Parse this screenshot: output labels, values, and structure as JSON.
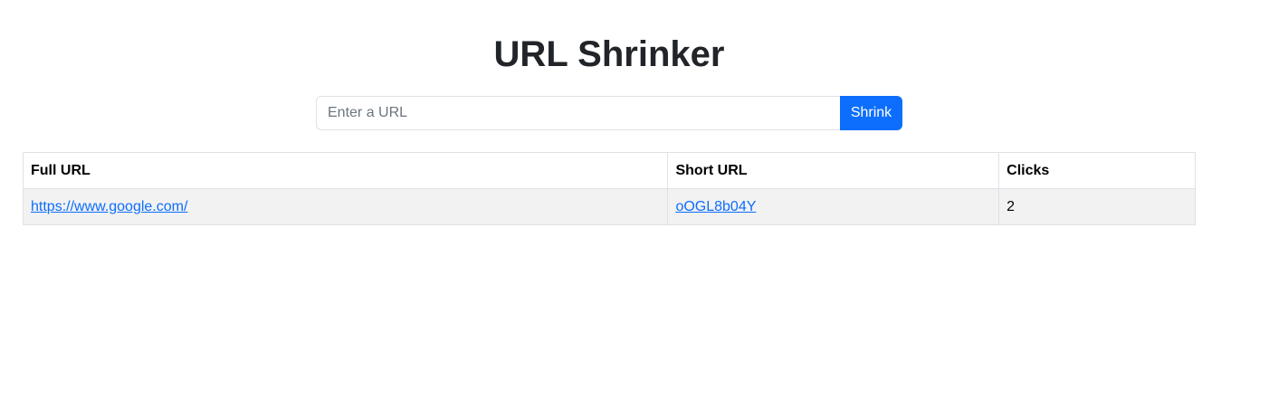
{
  "header": {
    "title": "URL Shrinker"
  },
  "form": {
    "input_placeholder": "Enter a URL",
    "input_value": "",
    "submit_label": "Shrink"
  },
  "table": {
    "columns": [
      "Full URL",
      "Short URL",
      "Clicks"
    ],
    "rows": [
      {
        "full_url": "https://www.google.com/",
        "short_url": "oOGL8b04Y",
        "clicks": "2"
      }
    ]
  },
  "colors": {
    "accent": "#0d6efd",
    "row_stripe": "#f2f2f2",
    "border": "#dee2e6"
  }
}
